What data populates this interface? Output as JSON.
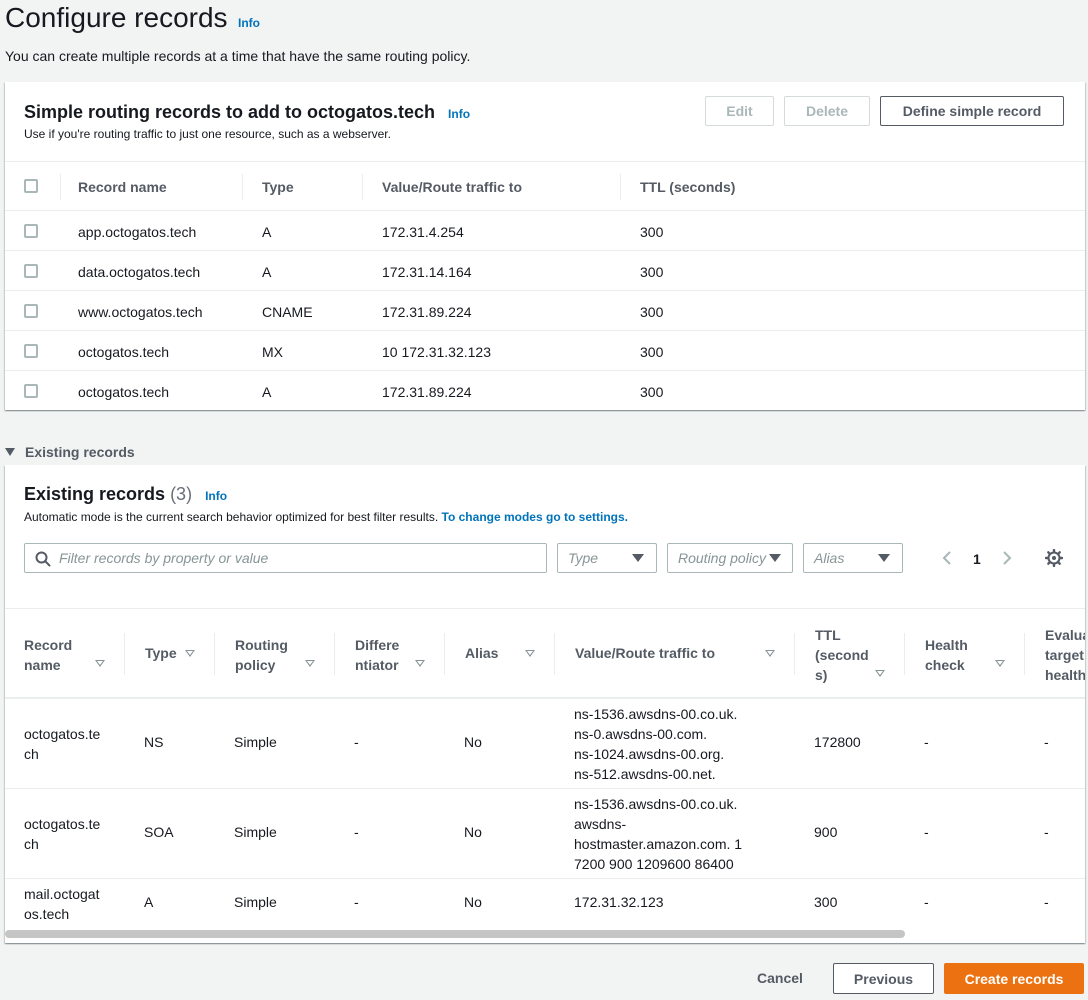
{
  "page": {
    "title": "Configure records",
    "info": "Info",
    "description": "You can create multiple records at a time that have the same routing policy."
  },
  "simple_panel": {
    "title": "Simple routing records to add to octogatos.tech",
    "info": "Info",
    "description": "Use if you're routing traffic to just one resource, such as a webserver.",
    "edit_label": "Edit",
    "delete_label": "Delete",
    "define_label": "Define simple record",
    "columns": [
      "Record name",
      "Type",
      "Value/Route traffic to",
      "TTL (seconds)"
    ],
    "rows": [
      {
        "name": "app.octogatos.tech",
        "type": "A",
        "value": "172.31.4.254",
        "ttl": "300"
      },
      {
        "name": "data.octogatos.tech",
        "type": "A",
        "value": "172.31.14.164",
        "ttl": "300"
      },
      {
        "name": "www.octogatos.tech",
        "type": "CNAME",
        "value": "172.31.89.224",
        "ttl": "300"
      },
      {
        "name": "octogatos.tech",
        "type": "MX",
        "value": "10 172.31.32.123",
        "ttl": "300"
      },
      {
        "name": "octogatos.tech",
        "type": "A",
        "value": "172.31.89.224",
        "ttl": "300"
      }
    ]
  },
  "existing_section": {
    "toggle_label": "Existing records",
    "title": "Existing records",
    "count": "(3)",
    "info": "Info",
    "description": "Automatic mode is the current search behavior optimized for best filter results.",
    "settings_link": "To change modes go to settings.",
    "search_placeholder": "Filter records by property or value",
    "filters": {
      "type": "Type",
      "routing": "Routing policy",
      "alias": "Alias"
    },
    "page_number": "1",
    "columns": {
      "record_name": [
        "Record",
        "name"
      ],
      "type": "Type",
      "routing": [
        "Routing",
        "policy"
      ],
      "differentiator": [
        "Differe",
        "ntiator"
      ],
      "alias": "Alias",
      "value": "Value/Route traffic to",
      "ttl": [
        "TTL",
        "(second",
        "s)"
      ],
      "health": [
        "Health",
        "check"
      ],
      "evaluate": [
        "Evalua",
        "target",
        "health"
      ]
    },
    "rows": [
      {
        "name": [
          "octogatos.te",
          "ch"
        ],
        "type": "NS",
        "routing": "Simple",
        "diff": "-",
        "alias": "No",
        "value": [
          "ns-1536.awsdns-00.co.uk.",
          "ns-0.awsdns-00.com.",
          "ns-1024.awsdns-00.org.",
          "ns-512.awsdns-00.net."
        ],
        "ttl": "172800",
        "health": "-",
        "evaluate": "-"
      },
      {
        "name": [
          "octogatos.te",
          "ch"
        ],
        "type": "SOA",
        "routing": "Simple",
        "diff": "-",
        "alias": "No",
        "value": [
          "ns-1536.awsdns-00.co.uk.",
          "awsdns-",
          "hostmaster.amazon.com. 1",
          "7200 900 1209600 86400"
        ],
        "ttl": "900",
        "health": "-",
        "evaluate": "-"
      },
      {
        "name": [
          "mail.octogat",
          "os.tech"
        ],
        "type": "A",
        "routing": "Simple",
        "diff": "-",
        "alias": "No",
        "value": [
          "172.31.32.123"
        ],
        "ttl": "300",
        "health": "-",
        "evaluate": "-"
      }
    ]
  },
  "footer": {
    "cancel": "Cancel",
    "previous": "Previous",
    "create": "Create records"
  },
  "colors": {
    "primary": "#ec7211",
    "link": "#0073bb"
  }
}
